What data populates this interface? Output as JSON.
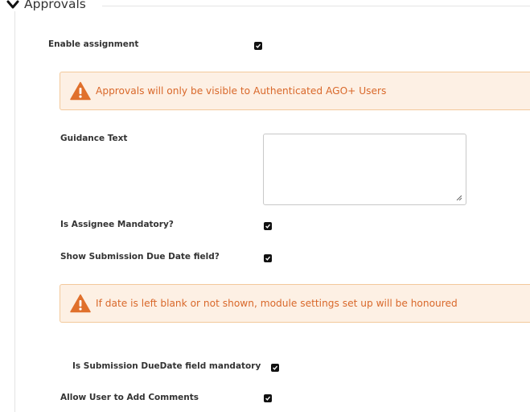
{
  "section": {
    "title": "Approvals",
    "chevron_icon": "chevron-down-icon"
  },
  "fields": {
    "enable_assignment": {
      "label": "Enable assignment",
      "checked": true
    },
    "guidance_text": {
      "label": "Guidance Text",
      "value": ""
    },
    "assignee_mandatory": {
      "label": "Is Assignee Mandatory?",
      "checked": true
    },
    "show_due_date": {
      "label": "Show Submission Due Date field?",
      "checked": true
    },
    "due_date_mandatory": {
      "label": "Is Submission DueDate field mandatory",
      "checked": true
    },
    "allow_comments": {
      "label": "Allow User to Add Comments",
      "checked": true
    }
  },
  "alerts": {
    "approvals_visibility": {
      "text": "Approvals will only be visible to Authenticated AGO+ Users",
      "icon": "warning-icon"
    },
    "due_date_note": {
      "text": "If date is left blank or not shown, module settings set up will be honoured",
      "icon": "warning-icon"
    }
  },
  "colors": {
    "warning_text": "#d9682a",
    "warning_bg": "#fdf0e4",
    "warning_border": "#f3c99b",
    "warning_icon": "#e0702c"
  }
}
